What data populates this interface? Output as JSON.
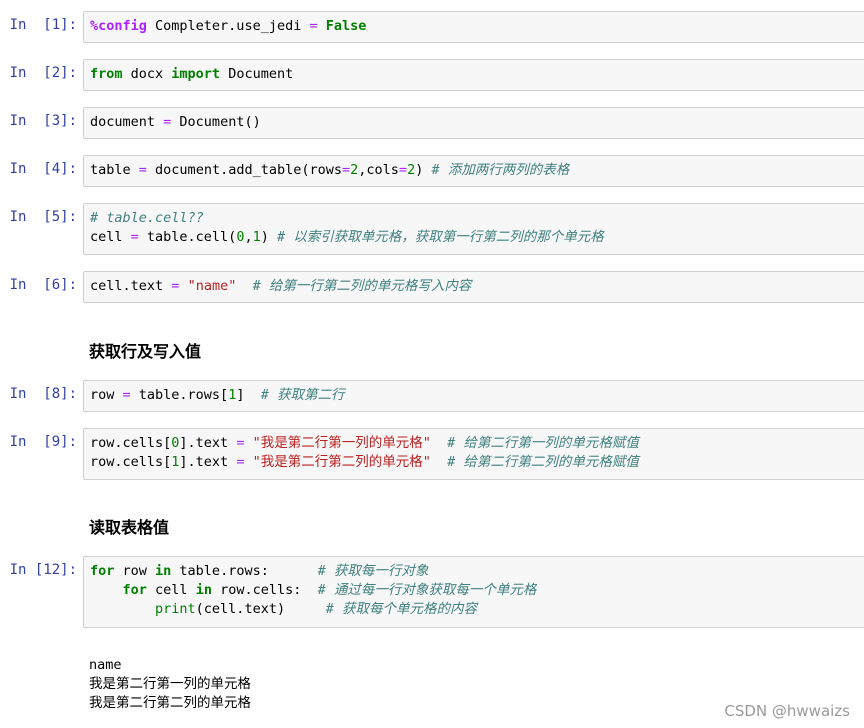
{
  "cells": [
    {
      "prompt": "In  [1]:",
      "lines": [
        [
          {
            "t": "%config",
            "c": "mg"
          },
          {
            "t": " Completer.use_jedi "
          },
          {
            "t": "=",
            "c": "op"
          },
          {
            "t": " "
          },
          {
            "t": "False",
            "c": "kw"
          }
        ]
      ]
    },
    {
      "prompt": "In  [2]:",
      "lines": [
        [
          {
            "t": "from",
            "c": "kw"
          },
          {
            "t": " docx "
          },
          {
            "t": "import",
            "c": "kw"
          },
          {
            "t": " Document"
          }
        ]
      ]
    },
    {
      "prompt": "In  [3]:",
      "lines": [
        [
          {
            "t": "document "
          },
          {
            "t": "=",
            "c": "op"
          },
          {
            "t": " Document()"
          }
        ]
      ]
    },
    {
      "prompt": "In  [4]:",
      "lines": [
        [
          {
            "t": "table "
          },
          {
            "t": "=",
            "c": "op"
          },
          {
            "t": " document.add_table(rows"
          },
          {
            "t": "=",
            "c": "op"
          },
          {
            "t": "2",
            "c": "num"
          },
          {
            "t": ",cols"
          },
          {
            "t": "=",
            "c": "op"
          },
          {
            "t": "2",
            "c": "num"
          },
          {
            "t": ") "
          },
          {
            "t": "# 添加两行两列的表格",
            "c": "cm"
          }
        ]
      ]
    },
    {
      "prompt": "In  [5]:",
      "lines": [
        [
          {
            "t": "# table.cell??",
            "c": "cm"
          }
        ],
        [
          {
            "t": "cell "
          },
          {
            "t": "=",
            "c": "op"
          },
          {
            "t": " table.cell("
          },
          {
            "t": "0",
            "c": "num"
          },
          {
            "t": ","
          },
          {
            "t": "1",
            "c": "num"
          },
          {
            "t": ") "
          },
          {
            "t": "# 以索引获取单元格，获取第一行第二列的那个单元格",
            "c": "cm"
          }
        ]
      ]
    },
    {
      "prompt": "In  [6]:",
      "lines": [
        [
          {
            "t": "cell.text "
          },
          {
            "t": "=",
            "c": "op"
          },
          {
            "t": " "
          },
          {
            "t": "\"name\"",
            "c": "str"
          },
          {
            "t": "  "
          },
          {
            "t": "# 给第一行第二列的单元格写入内容",
            "c": "cm"
          }
        ]
      ]
    },
    {
      "markdown": "获取行及写入值"
    },
    {
      "prompt": "In  [8]:",
      "lines": [
        [
          {
            "t": "row "
          },
          {
            "t": "=",
            "c": "op"
          },
          {
            "t": " table.rows["
          },
          {
            "t": "1",
            "c": "num"
          },
          {
            "t": "]  "
          },
          {
            "t": "# 获取第二行",
            "c": "cm"
          }
        ]
      ]
    },
    {
      "prompt": "In  [9]:",
      "lines": [
        [
          {
            "t": "row.cells["
          },
          {
            "t": "0",
            "c": "num"
          },
          {
            "t": "].text "
          },
          {
            "t": "=",
            "c": "op"
          },
          {
            "t": " "
          },
          {
            "t": "\"我是第二行第一列的单元格\"",
            "c": "str"
          },
          {
            "t": "  "
          },
          {
            "t": "# 给第二行第一列的单元格赋值",
            "c": "cm"
          }
        ],
        [
          {
            "t": "row.cells["
          },
          {
            "t": "1",
            "c": "num"
          },
          {
            "t": "].text "
          },
          {
            "t": "=",
            "c": "op"
          },
          {
            "t": " "
          },
          {
            "t": "\"我是第二行第二列的单元格\"",
            "c": "str"
          },
          {
            "t": "  "
          },
          {
            "t": "# 给第二行第二列的单元格赋值",
            "c": "cm"
          }
        ]
      ]
    },
    {
      "markdown": "读取表格值"
    },
    {
      "prompt": "In [12]:",
      "lines": [
        [
          {
            "t": "for",
            "c": "kw"
          },
          {
            "t": " row "
          },
          {
            "t": "in",
            "c": "kw"
          },
          {
            "t": " table.rows:      "
          },
          {
            "t": "# 获取每一行对象",
            "c": "cm"
          }
        ],
        [
          {
            "t": "    "
          },
          {
            "t": "for",
            "c": "kw"
          },
          {
            "t": " cell "
          },
          {
            "t": "in",
            "c": "kw"
          },
          {
            "t": " row.cells:  "
          },
          {
            "t": "# 通过每一行对象获取每一个单元格",
            "c": "cm"
          }
        ],
        [
          {
            "t": "        "
          },
          {
            "t": "print",
            "c": "bi"
          },
          {
            "t": "(cell.text)     "
          },
          {
            "t": "# 获取每个单元格的内容",
            "c": "cm"
          }
        ]
      ]
    },
    {
      "output": [
        "name",
        "我是第二行第一列的单元格",
        "我是第二行第二列的单元格"
      ]
    }
  ],
  "watermark": "CSDN @hwwaizs"
}
